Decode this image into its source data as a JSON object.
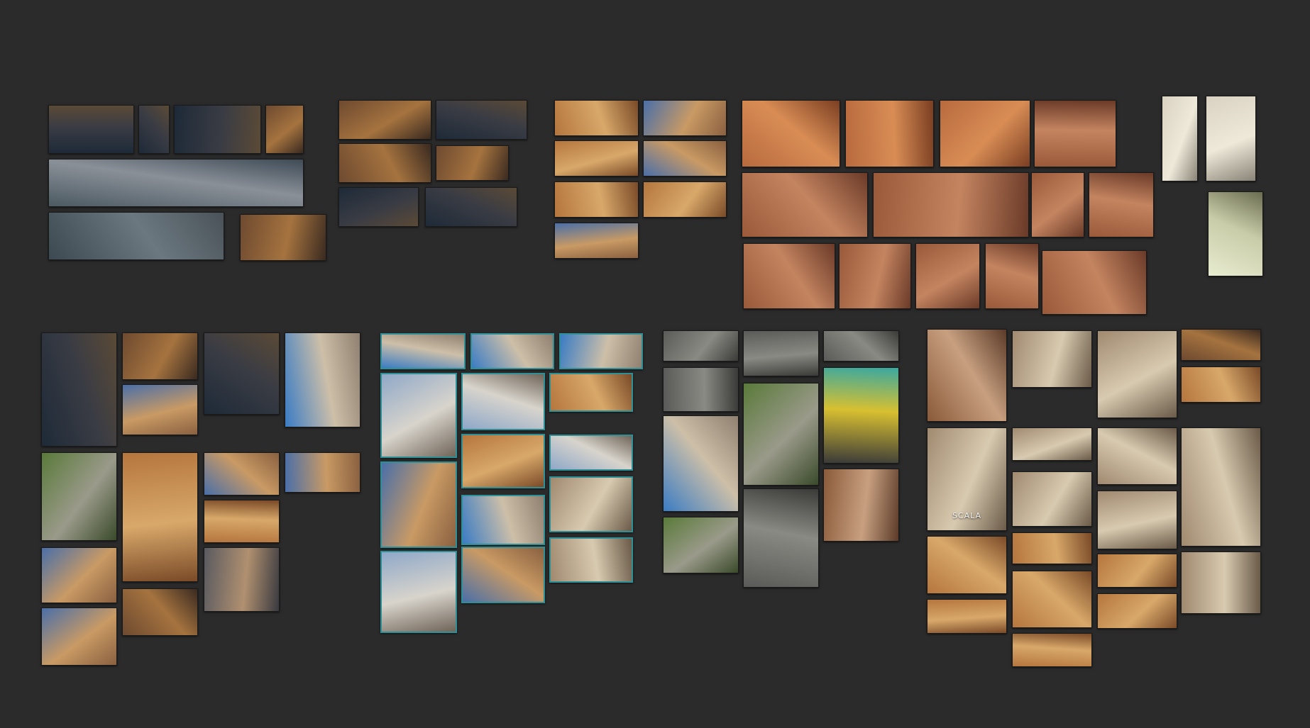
{
  "app": {
    "background": "#2b2b2b",
    "selection_color": "#2e8f96"
  },
  "palettes": {
    "night": [
      "#1e2a38",
      "#3a3c44",
      "#5b4a36"
    ],
    "blueprint": [
      "#3d4950",
      "#6b7880",
      "#4a5258"
    ],
    "render": [
      "#4c5a62",
      "#8a9098",
      "#3e4a55"
    ],
    "warm": [
      "#6e4a30",
      "#a5733f",
      "#3a2a20"
    ],
    "arcade": [
      "#b5763e",
      "#d8a86a",
      "#7a4a28"
    ],
    "courtyard": [
      "#4a6fa8",
      "#c99a64",
      "#8a6040"
    ],
    "tile": [
      "#b86a3e",
      "#d98d55",
      "#7a3e22"
    ],
    "roof": [
      "#9a5a3a",
      "#c48460",
      "#6a3a28"
    ],
    "sketch": [
      "#d9d2c2",
      "#efe9da",
      "#8a8478"
    ],
    "plan": [
      "#e8ecd0",
      "#c9cca8",
      "#6a6c50"
    ],
    "dome": [
      "#3a7cc4",
      "#cdbfa8",
      "#8f8070"
    ],
    "cloud": [
      "#8fa8c8",
      "#d8d4cc",
      "#706458"
    ],
    "stone": [
      "#5a5a58",
      "#8a8a84",
      "#3a3a38"
    ],
    "green": [
      "#5a7a3a",
      "#9a9a8a",
      "#3a4a2a"
    ],
    "sign": [
      "#3a3a38",
      "#d8c030",
      "#3aa8a0"
    ],
    "facade": [
      "#a08a70",
      "#d8cab0",
      "#6a5a48"
    ],
    "brick": [
      "#8a5a3a",
      "#c8a080",
      "#5a3a28"
    ],
    "dusk": [
      "#5a5a60",
      "#b09070",
      "#3a3a40"
    ]
  },
  "tiles": [
    {
      "id": "t01",
      "p": "night"
    },
    {
      "id": "t02",
      "p": "night"
    },
    {
      "id": "t03",
      "p": "night"
    },
    {
      "id": "t04",
      "p": "warm"
    },
    {
      "id": "t05",
      "p": "render"
    },
    {
      "id": "t06",
      "p": "blueprint"
    },
    {
      "id": "t07",
      "p": "warm"
    },
    {
      "id": "t08",
      "p": "warm"
    },
    {
      "id": "t09",
      "p": "night"
    },
    {
      "id": "t10",
      "p": "warm"
    },
    {
      "id": "t11",
      "p": "warm"
    },
    {
      "id": "t12",
      "p": "night"
    },
    {
      "id": "t13",
      "p": "night"
    },
    {
      "id": "t14",
      "p": "arcade"
    },
    {
      "id": "t15",
      "p": "courtyard"
    },
    {
      "id": "t16",
      "p": "arcade"
    },
    {
      "id": "t17",
      "p": "courtyard"
    },
    {
      "id": "t18",
      "p": "arcade"
    },
    {
      "id": "t19",
      "p": "arcade"
    },
    {
      "id": "t20",
      "p": "courtyard"
    },
    {
      "id": "t21",
      "p": "tile"
    },
    {
      "id": "t22",
      "p": "tile"
    },
    {
      "id": "t23",
      "p": "tile"
    },
    {
      "id": "t24",
      "p": "roof"
    },
    {
      "id": "t25",
      "p": "roof"
    },
    {
      "id": "t26",
      "p": "roof"
    },
    {
      "id": "t27",
      "p": "roof"
    },
    {
      "id": "t28",
      "p": "roof"
    },
    {
      "id": "t29",
      "p": "roof"
    },
    {
      "id": "t30",
      "p": "roof"
    },
    {
      "id": "t31",
      "p": "roof"
    },
    {
      "id": "t32",
      "p": "roof"
    },
    {
      "id": "t33",
      "p": "roof"
    },
    {
      "id": "t34",
      "p": "sketch"
    },
    {
      "id": "t35",
      "p": "sketch"
    },
    {
      "id": "t36",
      "p": "plan"
    },
    {
      "id": "t37",
      "p": "night"
    },
    {
      "id": "t38",
      "p": "warm"
    },
    {
      "id": "t39",
      "p": "courtyard"
    },
    {
      "id": "t40",
      "p": "night"
    },
    {
      "id": "t41",
      "p": "dome"
    },
    {
      "id": "t42",
      "p": "green"
    },
    {
      "id": "t43",
      "p": "arcade"
    },
    {
      "id": "t44",
      "p": "courtyard"
    },
    {
      "id": "t45",
      "p": "courtyard"
    },
    {
      "id": "t46",
      "p": "courtyard"
    },
    {
      "id": "t47",
      "p": "arcade"
    },
    {
      "id": "t48",
      "p": "warm"
    },
    {
      "id": "t49",
      "p": "dusk"
    },
    {
      "id": "t50",
      "p": "courtyard"
    },
    {
      "id": "t51",
      "p": "dome"
    },
    {
      "id": "t52",
      "p": "dome"
    },
    {
      "id": "t53",
      "p": "dome"
    },
    {
      "id": "t54",
      "p": "cloud"
    },
    {
      "id": "t55",
      "p": "cloud"
    },
    {
      "id": "t56",
      "p": "arcade"
    },
    {
      "id": "t57",
      "p": "courtyard"
    },
    {
      "id": "t58",
      "p": "arcade"
    },
    {
      "id": "t59",
      "p": "cloud"
    },
    {
      "id": "t60",
      "p": "dome"
    },
    {
      "id": "t61",
      "p": "facade"
    },
    {
      "id": "t62",
      "p": "cloud"
    },
    {
      "id": "t63",
      "p": "courtyard"
    },
    {
      "id": "t64",
      "p": "facade"
    },
    {
      "id": "t65",
      "p": "stone"
    },
    {
      "id": "t66",
      "p": "stone"
    },
    {
      "id": "t67",
      "p": "stone"
    },
    {
      "id": "t68",
      "p": "stone"
    },
    {
      "id": "t69",
      "p": "green"
    },
    {
      "id": "t70",
      "p": "sign"
    },
    {
      "id": "t71",
      "p": "dome"
    },
    {
      "id": "t72",
      "p": "brick"
    },
    {
      "id": "t73",
      "p": "green"
    },
    {
      "id": "t74",
      "p": "stone"
    },
    {
      "id": "t75",
      "p": "brick"
    },
    {
      "id": "t76",
      "p": "facade"
    },
    {
      "id": "t77",
      "p": "facade"
    },
    {
      "id": "t78",
      "p": "warm"
    },
    {
      "id": "t79",
      "p": "arcade"
    },
    {
      "id": "t80",
      "p": "facade",
      "label": "SCALA"
    },
    {
      "id": "t81",
      "p": "facade"
    },
    {
      "id": "t82",
      "p": "facade"
    },
    {
      "id": "t83",
      "p": "facade"
    },
    {
      "id": "t84",
      "p": "facade"
    },
    {
      "id": "t85",
      "p": "facade"
    },
    {
      "id": "t86",
      "p": "arcade"
    },
    {
      "id": "t87",
      "p": "arcade"
    },
    {
      "id": "t88",
      "p": "arcade"
    },
    {
      "id": "t89",
      "p": "arcade"
    },
    {
      "id": "t90",
      "p": "arcade"
    },
    {
      "id": "t91",
      "p": "facade"
    },
    {
      "id": "t92",
      "p": "arcade"
    },
    {
      "id": "t93",
      "p": "arcade"
    }
  ]
}
